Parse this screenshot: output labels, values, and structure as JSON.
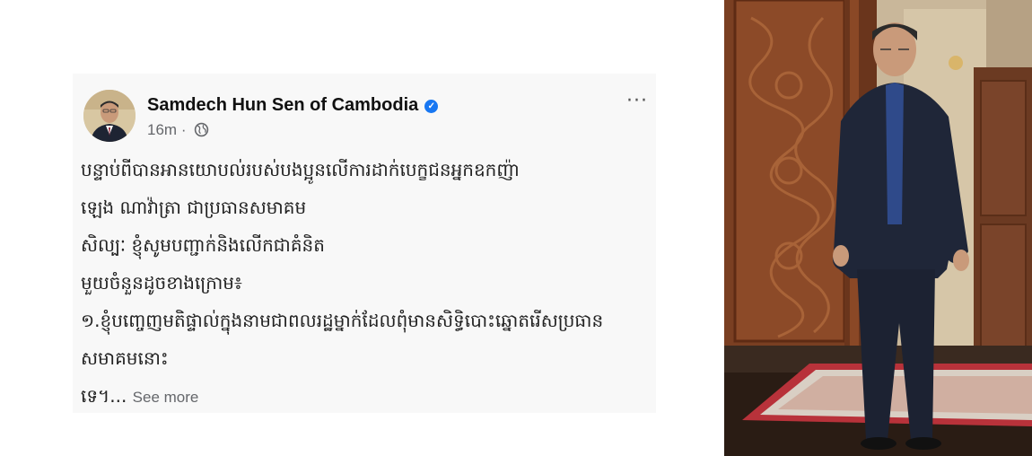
{
  "post": {
    "author": "Samdech Hun Sen of Cambodia",
    "verified_icon": "verified-badge-icon",
    "time": "16m",
    "separator": "·",
    "audience_icon": "globe-icon",
    "more_label": "···",
    "lines": [
      "បន្ទាប់ពីបានអានយោបល់របស់បងប្អូនលើការដាក់បេក្ខជនអ្នកឧកញ៉ា",
      "ឡេង ណាវ៉ាត្រា ជាប្រធានសមាគម",
      "សិល្បៈ ខ្ញុំសូមបញ្ជាក់និងលើកជាគំនិត",
      "មួយចំនួនដូចខាងក្រោម៖",
      "១.ខ្ញុំបញ្ចេញមតិផ្ទាល់ក្នុងនាមជាពលរដ្ឋម្នាក់ដែលពុំមានសិទ្ធិបោះឆ្នោតរើសប្រធាន",
      "សមាគមនោះ"
    ],
    "last_line": "ទេ។...",
    "see_more": "See more"
  },
  "colors": {
    "verified": "#1877f2",
    "meta": "#65676b",
    "card": "#f8f8f8"
  }
}
